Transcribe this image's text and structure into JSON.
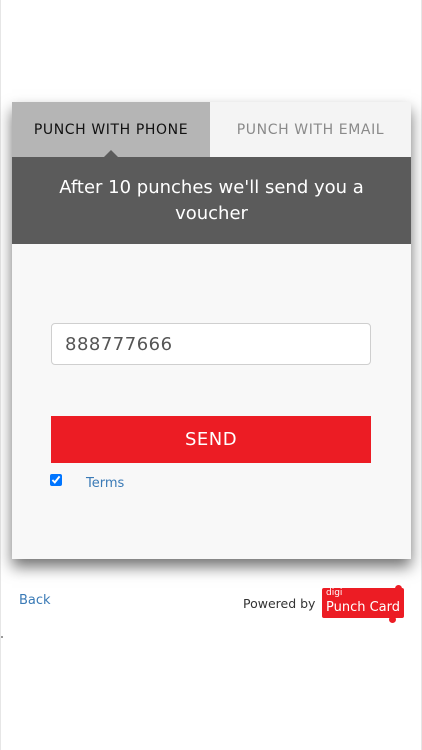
{
  "tabs": {
    "phone_label": "PUNCH WITH PHONE",
    "email_label": "PUNCH WITH EMAIL",
    "active": "phone"
  },
  "banner": {
    "text": "After 10 punches we'll send you a voucher"
  },
  "form": {
    "phone_value": "888777666",
    "send_label": "SEND",
    "terms_label": "Terms",
    "terms_checked": true
  },
  "footer": {
    "back_label": "Back",
    "powered_by_label": "Powered by",
    "logo_small_text": "digi",
    "logo_main_text": "Punch Card"
  },
  "colors": {
    "accent_red": "#ec1c24",
    "banner_gray": "#5b5b5b",
    "active_tab_gray": "#b5b5b5",
    "link_blue": "#3a7ab6"
  }
}
